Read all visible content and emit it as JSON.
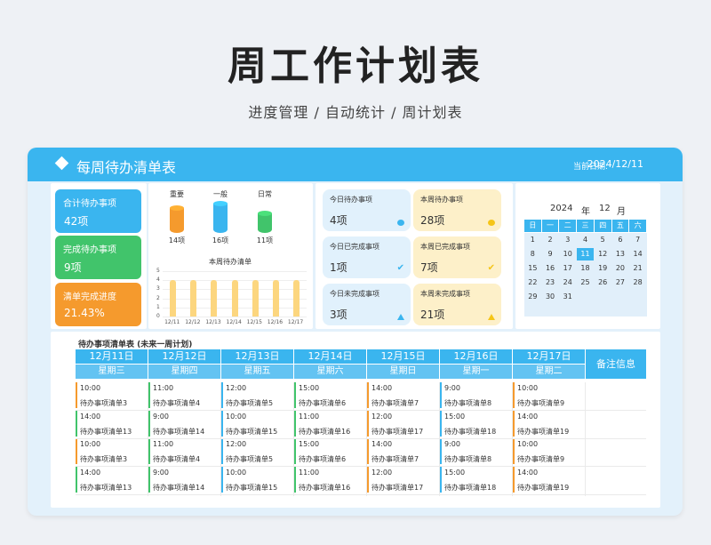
{
  "hero": {
    "title": "周工作计划表",
    "subtitle": "进度管理 / 自动统计 / 周计划表"
  },
  "header": {
    "title": "每周待办清单表",
    "date_label": "当前日期:",
    "date_value": "2024/12/11"
  },
  "stats": [
    {
      "label": "合计待办事项",
      "value": "42项",
      "color": "#3ab5ef"
    },
    {
      "label": "完成待办事项",
      "value": "9项",
      "color": "#41c46b"
    },
    {
      "label": "清单完成进度",
      "value": "21.43%",
      "color": "#f59a2d"
    }
  ],
  "categories": [
    {
      "label": "重要",
      "value": "14项",
      "count": 14,
      "color": "#f59a2d"
    },
    {
      "label": "一般",
      "value": "16项",
      "count": 16,
      "color": "#3ab5ef"
    },
    {
      "label": "日常",
      "value": "11项",
      "count": 11,
      "color": "#41c46b"
    }
  ],
  "weekly_chart": {
    "title": "本周待办清单",
    "y_ticks": [
      "5",
      "4",
      "3",
      "2",
      "1",
      "0"
    ]
  },
  "chart_data": {
    "type": "bar",
    "title": "本周待办清单",
    "categories": [
      "12/11",
      "12/12",
      "12/13",
      "12/14",
      "12/15",
      "12/16",
      "12/17"
    ],
    "values": [
      4,
      4,
      4,
      4,
      4,
      4,
      4
    ],
    "ylim": [
      0,
      5
    ]
  },
  "tasks": [
    {
      "label": "今日待办事项",
      "value": "4项",
      "bg": "#e1f1fc",
      "icon": "dot",
      "icon_color": "#3ab5ef"
    },
    {
      "label": "本周待办事项",
      "value": "28项",
      "bg": "#fdf0c9",
      "icon": "dot",
      "icon_color": "#f5c518"
    },
    {
      "label": "今日已完成事项",
      "value": "1项",
      "bg": "#e1f1fc",
      "icon": "check",
      "icon_color": "#3ab5ef"
    },
    {
      "label": "本周已完成事项",
      "value": "7项",
      "bg": "#fdf0c9",
      "icon": "check",
      "icon_color": "#f5c518"
    },
    {
      "label": "今日未完成事项",
      "value": "3项",
      "bg": "#e1f1fc",
      "icon": "triangle",
      "icon_color": "#3ab5ef"
    },
    {
      "label": "本周未完成事项",
      "value": "21项",
      "bg": "#fdf0c9",
      "icon": "triangle",
      "icon_color": "#f5c518"
    }
  ],
  "calendar": {
    "year": "2024",
    "year_suffix": "年",
    "month": "12",
    "month_suffix": "月",
    "weekdays": [
      "日",
      "一",
      "二",
      "三",
      "四",
      "五",
      "六"
    ],
    "weeks": [
      [
        "1",
        "2",
        "3",
        "4",
        "5",
        "6",
        "7"
      ],
      [
        "8",
        "9",
        "10",
        "11",
        "12",
        "13",
        "14"
      ],
      [
        "15",
        "16",
        "17",
        "18",
        "19",
        "20",
        "21"
      ],
      [
        "22",
        "23",
        "24",
        "25",
        "26",
        "27",
        "28"
      ],
      [
        "29",
        "30",
        "31",
        "",
        "",
        "",
        ""
      ]
    ],
    "today": "11"
  },
  "table": {
    "title": "待办事项清单表 (未来一周计划)",
    "note_header": "备注信息",
    "days": [
      {
        "date": "12月11日",
        "weekday": "星期三",
        "entries": [
          {
            "time": "10:00",
            "task": "待办事项清单3",
            "c": "#f59a2d"
          },
          {
            "time": "14:00",
            "task": "待办事项清单13",
            "c": "#41c46b"
          },
          {
            "time": "10:00",
            "task": "待办事项清单3",
            "c": "#f59a2d"
          },
          {
            "time": "14:00",
            "task": "待办事项清单13",
            "c": "#41c46b"
          }
        ]
      },
      {
        "date": "12月12日",
        "weekday": "星期四",
        "entries": [
          {
            "time": "11:00",
            "task": "待办事项清单4",
            "c": "#41c46b"
          },
          {
            "time": "9:00",
            "task": "待办事项清单14",
            "c": "#41c46b"
          },
          {
            "time": "11:00",
            "task": "待办事项清单4",
            "c": "#41c46b"
          },
          {
            "time": "9:00",
            "task": "待办事项清单14",
            "c": "#41c46b"
          }
        ]
      },
      {
        "date": "12月13日",
        "weekday": "星期五",
        "entries": [
          {
            "time": "12:00",
            "task": "待办事项清单5",
            "c": "#3ab5ef"
          },
          {
            "time": "10:00",
            "task": "待办事项清单15",
            "c": "#3ab5ef"
          },
          {
            "time": "12:00",
            "task": "待办事项清单5",
            "c": "#3ab5ef"
          },
          {
            "time": "10:00",
            "task": "待办事项清单15",
            "c": "#3ab5ef"
          }
        ]
      },
      {
        "date": "12月14日",
        "weekday": "星期六",
        "entries": [
          {
            "time": "15:00",
            "task": "待办事项清单6",
            "c": "#41c46b"
          },
          {
            "time": "11:00",
            "task": "待办事项清单16",
            "c": "#41c46b"
          },
          {
            "time": "15:00",
            "task": "待办事项清单6",
            "c": "#41c46b"
          },
          {
            "time": "11:00",
            "task": "待办事项清单16",
            "c": "#41c46b"
          }
        ]
      },
      {
        "date": "12月15日",
        "weekday": "星期日",
        "entries": [
          {
            "time": "14:00",
            "task": "待办事项清单7",
            "c": "#f59a2d"
          },
          {
            "time": "12:00",
            "task": "待办事项清单17",
            "c": "#f59a2d"
          },
          {
            "time": "14:00",
            "task": "待办事项清单7",
            "c": "#f59a2d"
          },
          {
            "time": "12:00",
            "task": "待办事项清单17",
            "c": "#f59a2d"
          }
        ]
      },
      {
        "date": "12月16日",
        "weekday": "星期一",
        "entries": [
          {
            "time": "9:00",
            "task": "待办事项清单8",
            "c": "#3ab5ef"
          },
          {
            "time": "15:00",
            "task": "待办事项清单18",
            "c": "#3ab5ef"
          },
          {
            "time": "9:00",
            "task": "待办事项清单8",
            "c": "#3ab5ef"
          },
          {
            "time": "15:00",
            "task": "待办事项清单18",
            "c": "#3ab5ef"
          }
        ]
      },
      {
        "date": "12月17日",
        "weekday": "星期二",
        "entries": [
          {
            "time": "10:00",
            "task": "待办事项清单9",
            "c": "#f59a2d"
          },
          {
            "time": "14:00",
            "task": "待办事项清单19",
            "c": "#f59a2d"
          },
          {
            "time": "10:00",
            "task": "待办事项清单9",
            "c": "#f59a2d"
          },
          {
            "time": "14:00",
            "task": "待办事项清单19",
            "c": "#f59a2d"
          }
        ]
      }
    ]
  }
}
